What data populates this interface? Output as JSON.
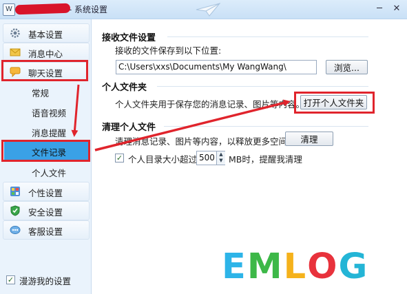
{
  "window": {
    "title": "夜寒韵雪之心 - 系统设置"
  },
  "sidebar": {
    "groups": [
      {
        "label": "基本设置",
        "icon": "gear-icon"
      },
      {
        "label": "消息中心",
        "icon": "envelope-icon"
      },
      {
        "label": "聊天设置",
        "icon": "chat-icon"
      },
      {
        "label": "个性设置",
        "icon": "palette-icon"
      },
      {
        "label": "安全设置",
        "icon": "shield-icon"
      },
      {
        "label": "客服设置",
        "icon": "support-icon"
      }
    ],
    "chat_subitems": [
      "常规",
      "语音视频",
      "消息提醒",
      "文件记录",
      "个人文件"
    ],
    "selected": "文件记录",
    "roaming_label": "漫游我的设置",
    "roaming_checked": true
  },
  "main": {
    "receive": {
      "title": "接收文件设置",
      "desc": "接收的文件保存到以下位置:",
      "path": "C:\\Users\\xxs\\Documents\\My WangWang\\",
      "browse_label": "浏览..."
    },
    "personal_folder": {
      "title": "个人文件夹",
      "desc": "个人文件夹用于保存您的消息记录、图片等内容。",
      "open_label": "打开个人文件夹"
    },
    "cleanup": {
      "title": "清理个人文件",
      "desc": "清理消息记录、图片等内容，以释放更多空间",
      "clean_label": "清理",
      "threshold_prefix": "个人目录大小超过",
      "threshold_value": "500",
      "threshold_suffix": "MB时，提醒我清理",
      "threshold_checked": true
    }
  },
  "watermark": {
    "text": "EMLOG",
    "letters": [
      "E",
      "M",
      "L",
      "O",
      "G"
    ],
    "colors": [
      "#2db4e8",
      "#3db848",
      "#f5b21c",
      "#e8323c",
      "#24b5d6"
    ]
  },
  "annotation_color": "#e0242c"
}
